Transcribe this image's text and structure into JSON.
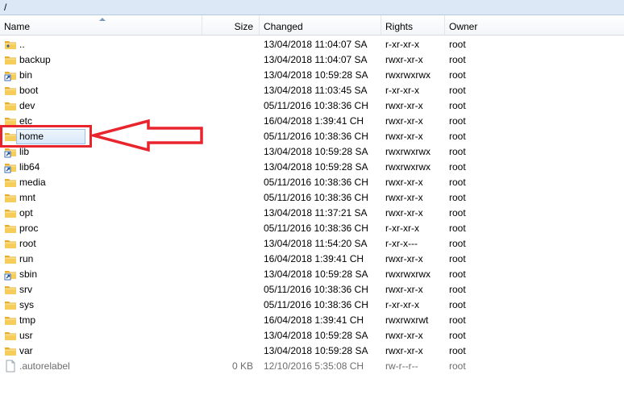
{
  "path": {
    "text": "/"
  },
  "columns": {
    "name": "Name",
    "size": "Size",
    "changed": "Changed",
    "rights": "Rights",
    "owner": "Owner"
  },
  "files": [
    {
      "name": "..",
      "size": "",
      "changed": "13/04/2018 11:04:07 SA",
      "rights": "r-xr-xr-x",
      "owner": "root",
      "icon": "parent-folder-icon"
    },
    {
      "name": "backup",
      "size": "",
      "changed": "13/04/2018 11:04:07 SA",
      "rights": "rwxr-xr-x",
      "owner": "root",
      "icon": "folder-icon"
    },
    {
      "name": "bin",
      "size": "",
      "changed": "13/04/2018 10:59:28 SA",
      "rights": "rwxrwxrwx",
      "owner": "root",
      "icon": "folder-link-icon"
    },
    {
      "name": "boot",
      "size": "",
      "changed": "13/04/2018 11:03:45 SA",
      "rights": "r-xr-xr-x",
      "owner": "root",
      "icon": "folder-icon"
    },
    {
      "name": "dev",
      "size": "",
      "changed": "05/11/2016 10:38:36 CH",
      "rights": "rwxr-xr-x",
      "owner": "root",
      "icon": "folder-icon"
    },
    {
      "name": "etc",
      "size": "",
      "changed": "16/04/2018 1:39:41 CH",
      "rights": "rwxr-xr-x",
      "owner": "root",
      "icon": "folder-icon"
    },
    {
      "name": "home",
      "size": "",
      "changed": "05/11/2016 10:38:36 CH",
      "rights": "rwxr-xr-x",
      "owner": "root",
      "icon": "folder-icon",
      "selected": true
    },
    {
      "name": "lib",
      "size": "",
      "changed": "13/04/2018 10:59:28 SA",
      "rights": "rwxrwxrwx",
      "owner": "root",
      "icon": "folder-link-icon"
    },
    {
      "name": "lib64",
      "size": "",
      "changed": "13/04/2018 10:59:28 SA",
      "rights": "rwxrwxrwx",
      "owner": "root",
      "icon": "folder-link-icon"
    },
    {
      "name": "media",
      "size": "",
      "changed": "05/11/2016 10:38:36 CH",
      "rights": "rwxr-xr-x",
      "owner": "root",
      "icon": "folder-icon"
    },
    {
      "name": "mnt",
      "size": "",
      "changed": "05/11/2016 10:38:36 CH",
      "rights": "rwxr-xr-x",
      "owner": "root",
      "icon": "folder-icon"
    },
    {
      "name": "opt",
      "size": "",
      "changed": "13/04/2018 11:37:21 SA",
      "rights": "rwxr-xr-x",
      "owner": "root",
      "icon": "folder-icon"
    },
    {
      "name": "proc",
      "size": "",
      "changed": "05/11/2016 10:38:36 CH",
      "rights": "r-xr-xr-x",
      "owner": "root",
      "icon": "folder-icon"
    },
    {
      "name": "root",
      "size": "",
      "changed": "13/04/2018 11:54:20 SA",
      "rights": "r-xr-x---",
      "owner": "root",
      "icon": "folder-icon"
    },
    {
      "name": "run",
      "size": "",
      "changed": "16/04/2018 1:39:41 CH",
      "rights": "rwxr-xr-x",
      "owner": "root",
      "icon": "folder-icon"
    },
    {
      "name": "sbin",
      "size": "",
      "changed": "13/04/2018 10:59:28 SA",
      "rights": "rwxrwxrwx",
      "owner": "root",
      "icon": "folder-link-icon"
    },
    {
      "name": "srv",
      "size": "",
      "changed": "05/11/2016 10:38:36 CH",
      "rights": "rwxr-xr-x",
      "owner": "root",
      "icon": "folder-icon"
    },
    {
      "name": "sys",
      "size": "",
      "changed": "05/11/2016 10:38:36 CH",
      "rights": "r-xr-xr-x",
      "owner": "root",
      "icon": "folder-icon"
    },
    {
      "name": "tmp",
      "size": "",
      "changed": "16/04/2018 1:39:41 CH",
      "rights": "rwxrwxrwt",
      "owner": "root",
      "icon": "folder-icon"
    },
    {
      "name": "usr",
      "size": "",
      "changed": "13/04/2018 10:59:28 SA",
      "rights": "rwxr-xr-x",
      "owner": "root",
      "icon": "folder-icon"
    },
    {
      "name": "var",
      "size": "",
      "changed": "13/04/2018 10:59:28 SA",
      "rights": "rwxr-xr-x",
      "owner": "root",
      "icon": "folder-icon"
    },
    {
      "name": ".autorelabel",
      "size": "0 KB",
      "changed": "12/10/2016 5:35:08 CH",
      "rights": "rw-r--r--",
      "owner": "root",
      "icon": "file-icon",
      "hidden": true
    }
  ],
  "colors": {
    "annotation": "#e8242c",
    "folder": "#f2c14e",
    "selection_border": "#9dc0e6"
  }
}
